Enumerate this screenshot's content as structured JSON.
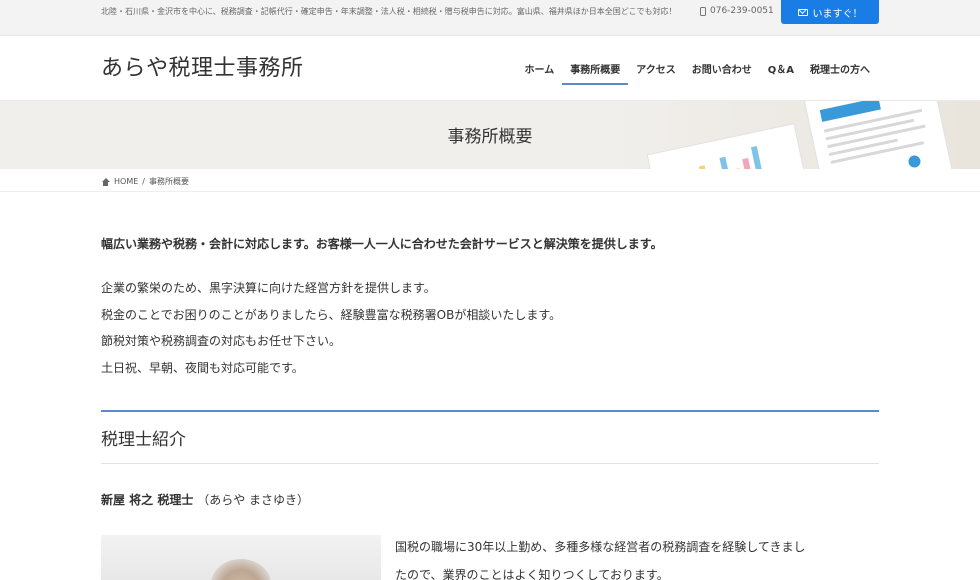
{
  "topbar": {
    "text": "北陸・石川県・金沢市を中心に、税務調査・記帳代行・確定申告・年末調整・法人税・相続税・贈与税申告に対応。富山県、福井県ほか日本全国どこでも対応！",
    "phone": "076-239-0051",
    "contact_label": "いますぐ！"
  },
  "header": {
    "site_title": "あらや税理士事務所",
    "nav": [
      {
        "label": "ホーム"
      },
      {
        "label": "事務所概要",
        "active": true
      },
      {
        "label": "アクセス"
      },
      {
        "label": "お問い合わせ"
      },
      {
        "label": "Q＆A"
      },
      {
        "label": "税理士の方へ"
      }
    ]
  },
  "banner": {
    "title": "事務所概要"
  },
  "breadcrumb": {
    "home": "HOME",
    "sep": "/",
    "current": "事務所概要"
  },
  "content": {
    "lead": "幅広い業務や税務・会計に対応します。お客様一人一人に合わせた会計サービスと解決策を提供します。",
    "lines": [
      "企業の繁栄のため、黒字決算に向けた経営方針を提供します。",
      "税金のことでお困りのことがありましたら、経験豊富な税務署OBが相談いたします。",
      "節税対策や税務調査の対応もお任せ下さい。",
      "土日祝、早朝、夜間も対応可能です。"
    ],
    "section_title": "税理士紹介",
    "person_name": "新屋 将之 税理士",
    "person_kana": "（あらや まさゆき）",
    "bio_lines": [
      "国税の職場に30年以上勤め、多種多様な経営者の税務調査を経験してきまし",
      "たので、業界のことはよく知りつくしております。"
    ]
  },
  "colors": {
    "accent": "#1a7de6",
    "rule": "#5b8bc7"
  },
  "icons": {
    "phone": "phone-icon",
    "mail": "mail-icon",
    "home": "home-icon"
  }
}
